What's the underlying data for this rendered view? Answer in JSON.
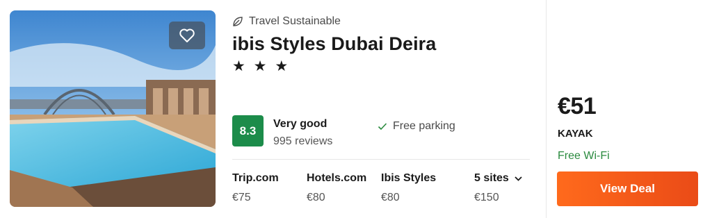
{
  "listing": {
    "sustainability_label": "Travel Sustainable",
    "hotel_name": "ibis Styles Dubai Deira",
    "stars_text": "★ ★ ★",
    "star_count": 3,
    "score": "8.3",
    "rating_label": "Very good",
    "reviews": "995 reviews",
    "amenity": "Free parking",
    "sites": [
      {
        "name": "Trip.com",
        "price": "€75"
      },
      {
        "name": "Hotels.com",
        "price": "€80"
      },
      {
        "name": "Ibis Styles",
        "price": "€80"
      }
    ],
    "more_sites": {
      "label": "5 sites",
      "price": "€150"
    }
  },
  "deal": {
    "price": "€51",
    "provider": "KAYAK",
    "perk": "Free Wi-Fi",
    "button_label": "View Deal"
  },
  "colors": {
    "score_badge": "#1c8c4a",
    "deal_button": "#ff6a1c",
    "perk_text": "#2a8a3e"
  },
  "icons": {
    "favorite": "heart-icon",
    "sustainable": "leaf-icon",
    "amenity": "check-icon",
    "more_sites": "chevron-down-icon"
  }
}
